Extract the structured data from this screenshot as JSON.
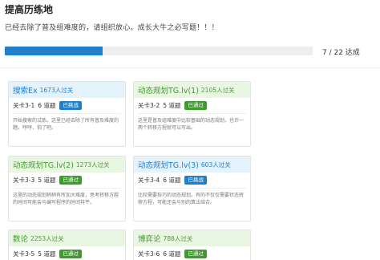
{
  "page": {
    "title": "提高历练地",
    "subtitle": "已经去除了普及组难度的，请组织放心。成长大牛之必写题！！！"
  },
  "progress": {
    "completed": 7,
    "total": 22,
    "label": "7 / 22 达成",
    "fraction": 0.318,
    "color": "#1f80c9"
  },
  "colors": {
    "blue": "#1f80c9",
    "green": "#3e9c2c"
  },
  "cards": [
    {
      "title": "搜索Ex",
      "count": "1673人过关",
      "level": "关卡3-1",
      "problems": "6 道题",
      "status": "已挑战",
      "status_color": "blue",
      "desc": "开始搜索的试炼。这里已经去除了所有普及难度的题。哼哼，怕了吧。"
    },
    {
      "title": "动态规划TG.lv(1)",
      "count": "2105人过关",
      "level": "关卡3-2",
      "problems": "5 道题",
      "status": "已通过",
      "status_color": "green",
      "desc": "这里是普及组难度中比较基础的动态规划，也许一两个转移方程就可以写出。"
    },
    {
      "title": "动态规划TG.lv(2)",
      "count": "1273人过关",
      "level": "关卡3-3",
      "problems": "5 道题",
      "status": "已通过",
      "status_color": "green",
      "desc": "这里的动态规划稍稍有所加大难度，思考转移方程的时间可能会与编写程序的时间持平。"
    },
    {
      "title": "动态规划TG.lv(3)",
      "count": "603人过关",
      "level": "关卡3-4",
      "problems": "6 道题",
      "status": "已挑战",
      "status_color": "blue",
      "desc": "比较需要技巧的动态规划。有的不仅仅需要状态转移方程，可能还会与别的算法结合。"
    },
    {
      "title": "数论",
      "count": "2253人过关",
      "level": "关卡3-5",
      "problems": "5 道题",
      "status": "已通过",
      "status_color": "green",
      "desc": ""
    },
    {
      "title": "博弈论",
      "count": "788人过关",
      "level": "关卡3-6",
      "problems": "6 道题",
      "status": "已通过",
      "status_color": "green",
      "desc": ""
    }
  ]
}
